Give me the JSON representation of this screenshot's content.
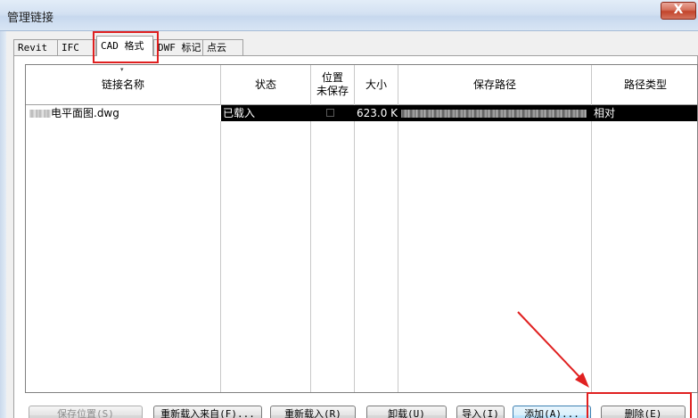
{
  "window": {
    "title": "管理链接",
    "close_glyph": "X"
  },
  "tabs": [
    {
      "label": "Revit",
      "active": false
    },
    {
      "label": "IFC",
      "active": false
    },
    {
      "label": "CAD 格式",
      "active": true
    },
    {
      "label": "DWF 标记",
      "active": false
    },
    {
      "label": "点云",
      "active": false
    }
  ],
  "table": {
    "headers": {
      "name": "链接名称",
      "status": "状态",
      "position": "位置\n未保存",
      "size": "大小",
      "path": "保存路径",
      "path_type": "路径类型"
    },
    "rows": [
      {
        "name": "电平面图.dwg",
        "status": "已载入",
        "position_unsaved": false,
        "size": "623.0 K",
        "path_type": "相对",
        "selected": true
      }
    ]
  },
  "buttons": {
    "save_position": "保存位置(S)",
    "reload_from": "重新载入来自(F)...",
    "reload": "重新载入(R)",
    "unload": "卸载(U)",
    "import": "导入(I)",
    "add": "添加(A)...",
    "delete": "删除(E)"
  },
  "colors": {
    "annotation": "#e02020",
    "selection": "#000000"
  }
}
